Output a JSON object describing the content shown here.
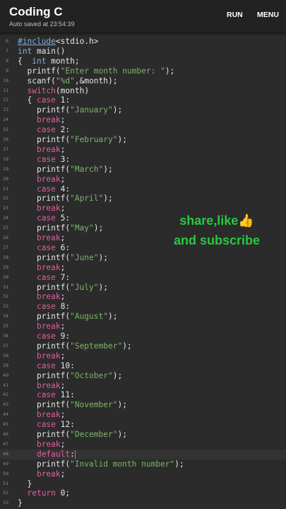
{
  "app": {
    "title": "Coding C",
    "autosave": "Auto saved at 23:54:39"
  },
  "toolbar": {
    "run_label": "RUN",
    "menu_label": "MENU"
  },
  "overlay": {
    "line1": "share,like",
    "thumb": "👍",
    "line2": "and subscribe"
  },
  "editor": {
    "line_numbers": [
      "6",
      "7",
      "8",
      "9",
      "10",
      "11",
      "12",
      "13",
      "14",
      "15",
      "16",
      "17",
      "18",
      "19",
      "20",
      "21",
      "22",
      "23",
      "24",
      "25",
      "26",
      "27",
      "28",
      "29",
      "30",
      "31",
      "32",
      "33",
      "34",
      "35",
      "36",
      "37",
      "38",
      "39",
      "40",
      "41",
      "42",
      "43",
      "44",
      "45",
      "46",
      "47",
      "48",
      "49",
      "50",
      "51",
      "52",
      "53"
    ],
    "lines": [
      [
        [
          "inc",
          "#include"
        ],
        [
          "p",
          "<stdio.h>"
        ]
      ],
      [
        [
          "t",
          "int"
        ],
        [
          "p",
          " main()"
        ]
      ],
      [
        [
          "p",
          "{  "
        ],
        [
          "t",
          "int"
        ],
        [
          "p",
          " month;"
        ]
      ],
      [
        [
          "p",
          "  printf("
        ],
        [
          "s",
          "\"Enter month number: \""
        ],
        [
          "p",
          ");"
        ]
      ],
      [
        [
          "p",
          "  scanf("
        ],
        [
          "s",
          "\"%d\""
        ],
        [
          "p",
          ",&month);"
        ]
      ],
      [
        [
          "p",
          "  "
        ],
        [
          "k",
          "switch"
        ],
        [
          "p",
          "(month)"
        ]
      ],
      [
        [
          "p",
          "  { "
        ],
        [
          "k",
          "case"
        ],
        [
          "p",
          " 1:"
        ]
      ],
      [
        [
          "p",
          "    printf("
        ],
        [
          "s",
          "\"January\""
        ],
        [
          "p",
          ");"
        ]
      ],
      [
        [
          "p",
          "    "
        ],
        [
          "k",
          "break"
        ],
        [
          "p",
          ";"
        ]
      ],
      [
        [
          "p",
          "    "
        ],
        [
          "k",
          "case"
        ],
        [
          "p",
          " 2:"
        ]
      ],
      [
        [
          "p",
          "    printf("
        ],
        [
          "s",
          "\"February\""
        ],
        [
          "p",
          ");"
        ]
      ],
      [
        [
          "p",
          "    "
        ],
        [
          "k",
          "break"
        ],
        [
          "p",
          ";"
        ]
      ],
      [
        [
          "p",
          "    "
        ],
        [
          "k",
          "case"
        ],
        [
          "p",
          " 3:"
        ]
      ],
      [
        [
          "p",
          "    printf("
        ],
        [
          "s",
          "\"March\""
        ],
        [
          "p",
          ");"
        ]
      ],
      [
        [
          "p",
          "    "
        ],
        [
          "k",
          "break"
        ],
        [
          "p",
          ";"
        ]
      ],
      [
        [
          "p",
          "    "
        ],
        [
          "k",
          "case"
        ],
        [
          "p",
          " 4:"
        ]
      ],
      [
        [
          "p",
          "    printf("
        ],
        [
          "s",
          "\"April\""
        ],
        [
          "p",
          ");"
        ]
      ],
      [
        [
          "p",
          "    "
        ],
        [
          "k",
          "break"
        ],
        [
          "p",
          ";"
        ]
      ],
      [
        [
          "p",
          "    "
        ],
        [
          "k",
          "case"
        ],
        [
          "p",
          " 5:"
        ]
      ],
      [
        [
          "p",
          "    printf("
        ],
        [
          "s",
          "\"May\""
        ],
        [
          "p",
          ");"
        ]
      ],
      [
        [
          "p",
          "    "
        ],
        [
          "k",
          "break"
        ],
        [
          "p",
          ";"
        ]
      ],
      [
        [
          "p",
          "    "
        ],
        [
          "k",
          "case"
        ],
        [
          "p",
          " 6:"
        ]
      ],
      [
        [
          "p",
          "    printf("
        ],
        [
          "s",
          "\"June\""
        ],
        [
          "p",
          ");"
        ]
      ],
      [
        [
          "p",
          "    "
        ],
        [
          "k",
          "break"
        ],
        [
          "p",
          ";"
        ]
      ],
      [
        [
          "p",
          "    "
        ],
        [
          "k",
          "case"
        ],
        [
          "p",
          " 7:"
        ]
      ],
      [
        [
          "p",
          "    printf("
        ],
        [
          "s",
          "\"July\""
        ],
        [
          "p",
          ");"
        ]
      ],
      [
        [
          "p",
          "    "
        ],
        [
          "k",
          "break"
        ],
        [
          "p",
          ";"
        ]
      ],
      [
        [
          "p",
          "    "
        ],
        [
          "k",
          "case"
        ],
        [
          "p",
          " 8:"
        ]
      ],
      [
        [
          "p",
          "    printf("
        ],
        [
          "s",
          "\"August\""
        ],
        [
          "p",
          ");"
        ]
      ],
      [
        [
          "p",
          "    "
        ],
        [
          "k",
          "break"
        ],
        [
          "p",
          ";"
        ]
      ],
      [
        [
          "p",
          "    "
        ],
        [
          "k",
          "case"
        ],
        [
          "p",
          " 9:"
        ]
      ],
      [
        [
          "p",
          "    printf("
        ],
        [
          "s",
          "\"September\""
        ],
        [
          "p",
          ");"
        ]
      ],
      [
        [
          "p",
          "    "
        ],
        [
          "k",
          "break"
        ],
        [
          "p",
          ";"
        ]
      ],
      [
        [
          "p",
          "    "
        ],
        [
          "k",
          "case"
        ],
        [
          "p",
          " 10:"
        ]
      ],
      [
        [
          "p",
          "    printf("
        ],
        [
          "s",
          "\"October\""
        ],
        [
          "p",
          ");"
        ]
      ],
      [
        [
          "p",
          "    "
        ],
        [
          "k",
          "break"
        ],
        [
          "p",
          ";"
        ]
      ],
      [
        [
          "p",
          "    "
        ],
        [
          "k",
          "case"
        ],
        [
          "p",
          " 11:"
        ]
      ],
      [
        [
          "p",
          "    printf("
        ],
        [
          "s",
          "\"November\""
        ],
        [
          "p",
          ");"
        ]
      ],
      [
        [
          "p",
          "    "
        ],
        [
          "k",
          "break"
        ],
        [
          "p",
          ";"
        ]
      ],
      [
        [
          "p",
          "    "
        ],
        [
          "k",
          "case"
        ],
        [
          "p",
          " 12:"
        ]
      ],
      [
        [
          "p",
          "    printf("
        ],
        [
          "s",
          "\"December\""
        ],
        [
          "p",
          ");"
        ]
      ],
      [
        [
          "p",
          "    "
        ],
        [
          "k",
          "break"
        ],
        [
          "p",
          ";"
        ]
      ],
      [
        [
          "p",
          "    "
        ],
        [
          "k",
          "default"
        ],
        [
          "p",
          ":"
        ]
      ],
      [
        [
          "p",
          "    printf("
        ],
        [
          "s",
          "\"Invalid month number\""
        ],
        [
          "p",
          ");"
        ]
      ],
      [
        [
          "p",
          "    "
        ],
        [
          "k",
          "break"
        ],
        [
          "p",
          ";"
        ]
      ],
      [
        [
          "p",
          "  }"
        ]
      ],
      [
        [
          "p",
          "  "
        ],
        [
          "k",
          "return"
        ],
        [
          "p",
          " 0;"
        ]
      ],
      [
        [
          "p",
          "}"
        ]
      ]
    ],
    "current_line": 42
  }
}
